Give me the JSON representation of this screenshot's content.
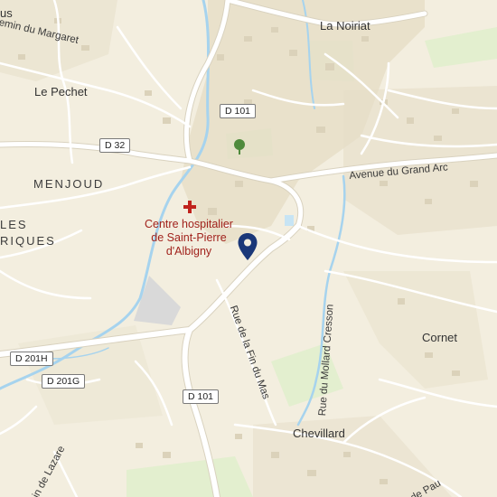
{
  "map": {
    "places": {
      "la_noiriat": "La Noiriat",
      "le_pechet": "Le Pechet",
      "menjoud": "MENJOUD",
      "les": "LES",
      "riques": "RIQUES",
      "cornet": "Cornet",
      "chevillard": "Chevillard",
      "us": "us"
    },
    "roads": {
      "d101_top": "D 101",
      "d32": "D 32",
      "d101_bottom": "D 101",
      "d201h": "D 201H",
      "d201g": "D 201G"
    },
    "streets": {
      "chemin_margaret": "emin du Margaret",
      "avenue_grand_arc": "Avenue du Grand Arc",
      "rue_fin_du_mas": "Rue de la Fin du Mas",
      "rue_mollard_cresson": "Rue du Mollard Cresson",
      "lazare": "in de Lazare",
      "pau": "de Pau"
    },
    "poi": {
      "hospital_line1": "Centre hospitalier",
      "hospital_line2": "de Saint-Pierre",
      "hospital_line3": "d'Albigny"
    },
    "colors": {
      "land": "#f3eedf",
      "road": "#ffffff",
      "water": "#a6d3ee",
      "park": "#dbeec7",
      "building": "#e4dcc6",
      "hospital": "#a1231d",
      "marker": "#1a3778"
    }
  }
}
